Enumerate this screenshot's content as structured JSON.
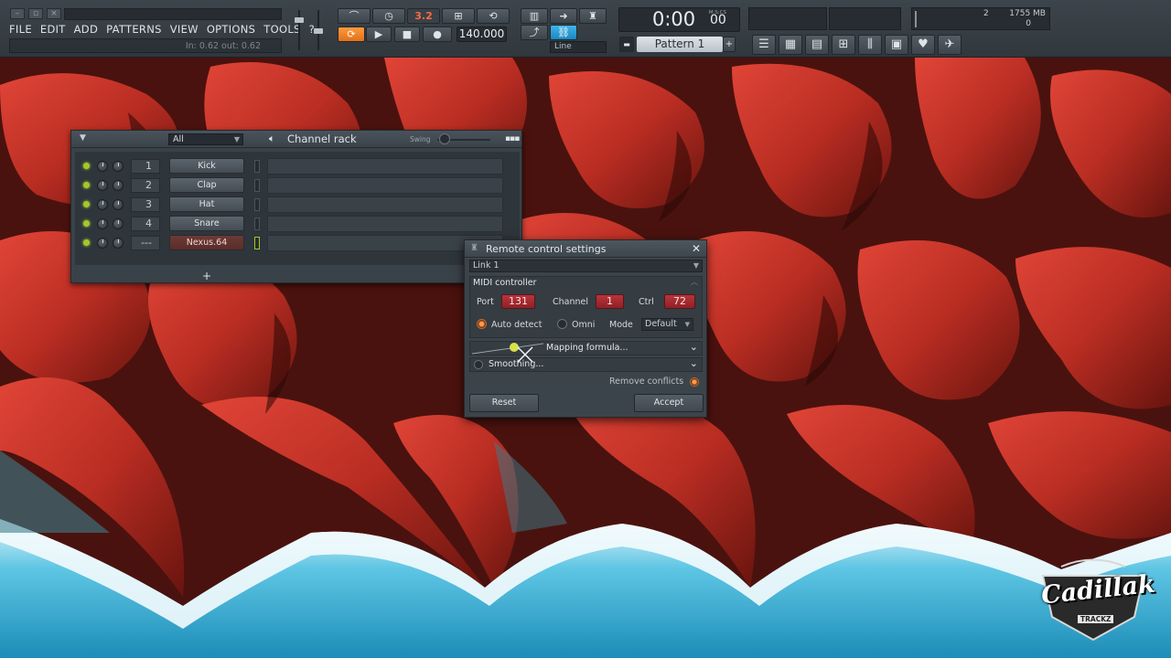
{
  "menu": [
    "FILE",
    "EDIT",
    "ADD",
    "PATTERNS",
    "VIEW",
    "OPTIONS",
    "TOOLS",
    "?"
  ],
  "hint": "In: 0.62 out: 0.62",
  "transport": {
    "loop_badge": "3.2",
    "tempo": "140.000",
    "time": "0:00",
    "time_sub": "00",
    "time_unit": "M:S:CS",
    "snap": "Line",
    "pattern": "Pattern 1",
    "pattern_add": "+"
  },
  "monitor": {
    "value_a": "2",
    "memory": "1755 MB",
    "value_b": "0"
  },
  "channel_rack": {
    "filter": "All",
    "title": "Channel rack",
    "swing_label": "Swing",
    "add": "+",
    "channels": [
      {
        "num": "1",
        "name": "Kick",
        "selected": false
      },
      {
        "num": "2",
        "name": "Clap",
        "selected": false
      },
      {
        "num": "3",
        "name": "Hat",
        "selected": false
      },
      {
        "num": "4",
        "name": "Snare",
        "selected": false
      },
      {
        "num": "---",
        "name": "Nexus.64",
        "selected": true
      }
    ]
  },
  "remote_control": {
    "title": "Remote control settings",
    "link": "Link 1",
    "section": "MIDI controller",
    "port_label": "Port",
    "port": "131",
    "channel_label": "Channel",
    "channel": "1",
    "ctrl_label": "Ctrl",
    "ctrl": "72",
    "auto_detect": "Auto detect",
    "omni": "Omni",
    "mode_label": "Mode",
    "mode": "Default",
    "mapping": "Mapping formula...",
    "smoothing": "Smoothing...",
    "remove_conflicts": "Remove conflicts",
    "reset": "Reset",
    "accept": "Accept"
  },
  "logo": {
    "text": "Cadillak",
    "sub": "TRACKZ"
  },
  "colors": {
    "accent": "#ff9a3c",
    "field_red": "#b8343a",
    "led": "#a4c829",
    "toolbar": "#353c42"
  }
}
